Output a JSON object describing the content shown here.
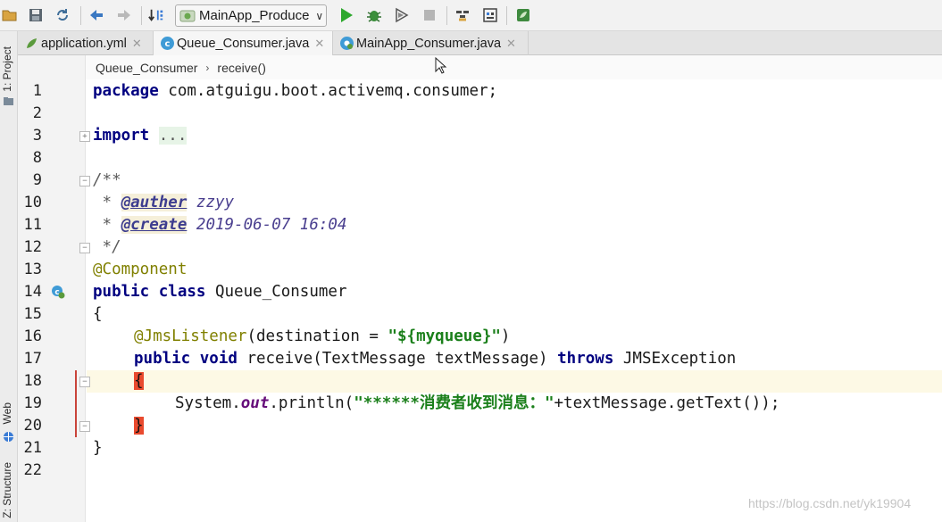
{
  "toolbar": {
    "run_config_label": "MainApp_Produce",
    "icons": [
      "open-folder-icon",
      "save-icon",
      "sync-icon",
      "back-icon",
      "forward-icon",
      "make-project-icon",
      "run-icon",
      "debug-icon",
      "coverage-icon",
      "stop-icon",
      "project-structure-icon",
      "sdk-icon",
      "spring-icon"
    ]
  },
  "left_strip": {
    "project_label": "1: Project",
    "web_label": "Web",
    "structure_label": "Z: Structure"
  },
  "tabs": [
    {
      "label": "application.yml",
      "active": false
    },
    {
      "label": "Queue_Consumer.java",
      "active": true
    },
    {
      "label": "MainApp_Consumer.java",
      "active": false
    }
  ],
  "breadcrumb": {
    "class_name": "Queue_Consumer",
    "separator": "›",
    "method_name": "receive()"
  },
  "code": {
    "line_numbers": [
      "1",
      "2",
      "3",
      "8",
      "9",
      "10",
      "11",
      "12",
      "13",
      "14",
      "15",
      "16",
      "17",
      "18",
      "19",
      "20",
      "21",
      "22"
    ],
    "l1_kw": "package",
    "l1_rest": " com.atguigu.boot.activemq.consumer;",
    "l3_kw": "import",
    "l3_fold": "...",
    "l9": "/**",
    "l10_star": " * ",
    "l10_tag": "@auther",
    "l10_val": " zzyy",
    "l11_star": " * ",
    "l11_tag": "@create",
    "l11_val": " 2019-06-07 16:04",
    "l12": " */",
    "l13": "@Component",
    "l14_kw": "public class",
    "l14_rest": " Queue_Consumer",
    "l15": "{",
    "l16_ann": "@JmsListener",
    "l16_mid": "(destination = ",
    "l16_str": "\"${myqueue}\"",
    "l16_end": ")",
    "l17_kw1": "public void",
    "l17_mid": " receive(TextMessage textMessage) ",
    "l17_kw2": "throws",
    "l17_end": " JMSException",
    "l18": "{",
    "l19_a": "System.",
    "l19_field": "out",
    "l19_b": ".println(",
    "l19_str": "\"******消费者收到消息：\"",
    "l19_c": "+textMessage.getText());",
    "l20": "}",
    "l21": "}"
  },
  "watermark": "https://blog.csdn.net/yk19904",
  "colors": {
    "keyword": "#000080",
    "annotation": "#808000",
    "string": "#1a7f1a",
    "brace_highlight": "#e94a2e",
    "caret_row": "#fdf9e5"
  }
}
